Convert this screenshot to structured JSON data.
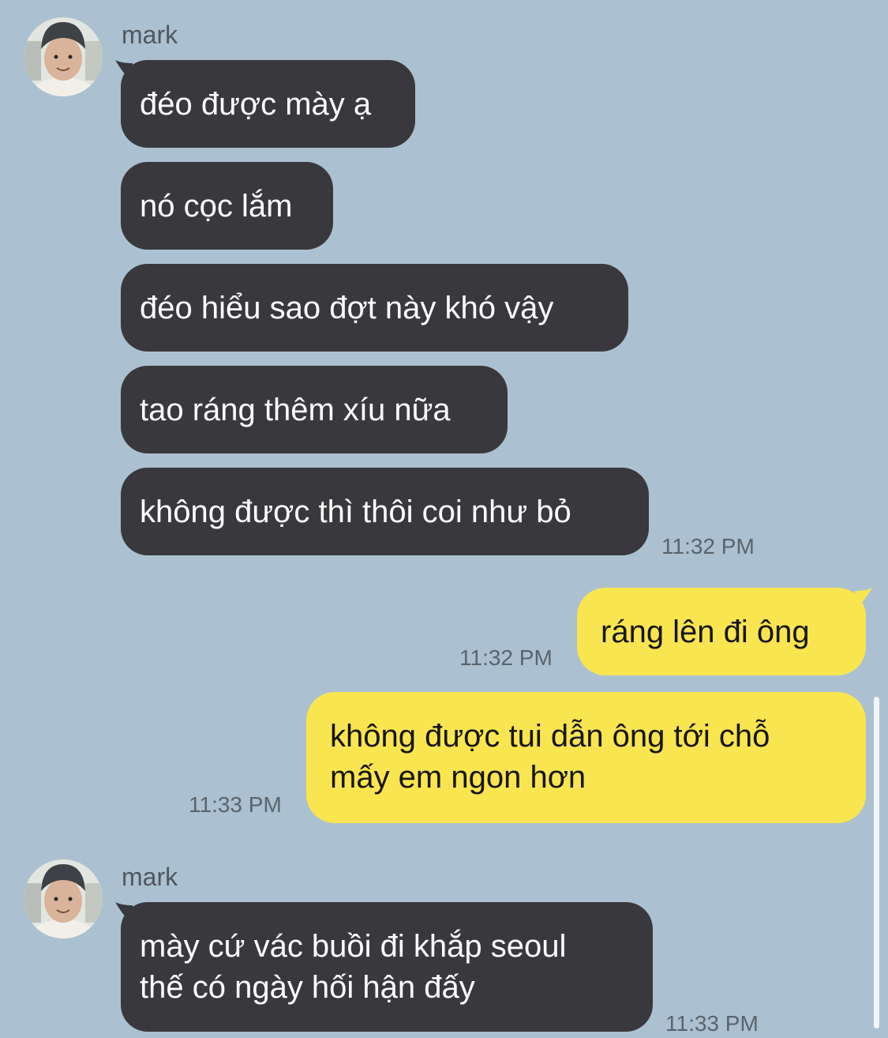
{
  "chat": {
    "groups": [
      {
        "sender": "mark",
        "messages": [
          "đéo được mày ạ",
          "nó cọc lắm",
          "đéo hiểu sao đợt này khó vậy",
          "tao ráng thêm xíu nữa",
          "không được thì thôi coi như bỏ"
        ],
        "time": "11:32 PM"
      },
      {
        "outgoing": [
          {
            "text": "ráng lên đi ông",
            "time": "11:32 PM"
          },
          {
            "line1": "không được tui dẫn ông tới chỗ",
            "line2": "mấy em ngon hơn",
            "time": "11:33 PM"
          }
        ]
      },
      {
        "sender": "mark",
        "line1": "mày cứ vác buồi đi khắp seoul",
        "line2": "thế có ngày hối hận đấy",
        "time": "11:33 PM"
      }
    ]
  },
  "colors": {
    "background": "#abc1d1",
    "incoming_bubble": "#39383c",
    "outgoing_bubble": "#f9e550"
  }
}
